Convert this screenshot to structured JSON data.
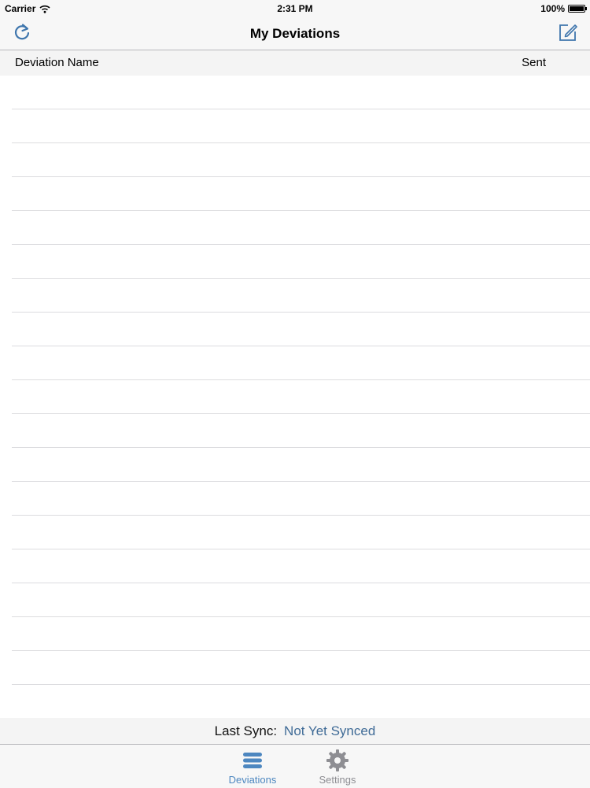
{
  "status_bar": {
    "carrier": "Carrier",
    "time": "2:31 PM",
    "battery": "100%"
  },
  "nav_bar": {
    "title": "My Deviations",
    "left_icon": "refresh-icon",
    "right_icon": "compose-icon"
  },
  "table": {
    "columns": [
      "Deviation Name",
      "Sent"
    ],
    "rows": []
  },
  "sync": {
    "label": "Last Sync:",
    "value": "Not Yet Synced"
  },
  "tabs": [
    {
      "label": "Deviations",
      "icon": "list-icon",
      "selected": true
    },
    {
      "label": "Settings",
      "icon": "gear-icon",
      "selected": false
    }
  ],
  "colors": {
    "accent": "#4d87c0",
    "sync_value": "#3e6a96",
    "tab_inactive": "#8e8e93"
  }
}
